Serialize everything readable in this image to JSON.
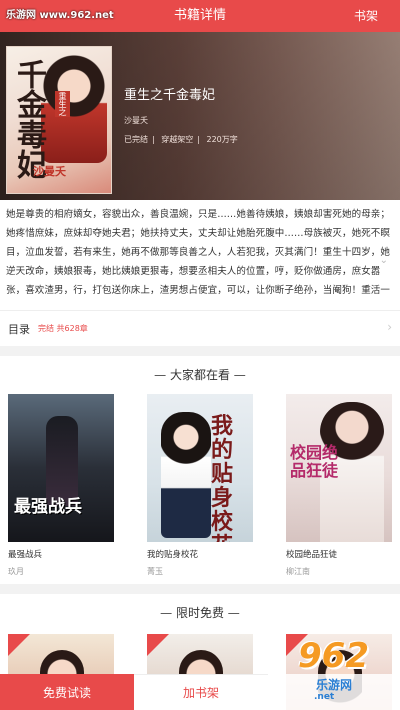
{
  "header": {
    "title": "书籍详情",
    "shelf_link": "书架",
    "watermark": "乐游网 www.962.net"
  },
  "book": {
    "title": "重生之千金毒妃",
    "author": "沙曼夭",
    "status": "已完结",
    "category": "穿越架空",
    "word_count": "220万字",
    "cover": {
      "title_text": "千金毒妃",
      "tag_text": "重生之",
      "author_text": "沙曼夭"
    },
    "description": "她是尊贵的相府嫡女，容貌出众，善良温婉，只是……她善待姨娘，姨娘却害死她的母亲；她疼惜庶妹，庶妹却夺她夫君；她扶持丈夫，丈夫却让她胎死腹中……母族被灭，她死不瞑目，泣血发誓，若有来生，她再不做那等良善之人，人若犯我，灭其满门！重生十四岁，她逆天改命，姨娘狠毒，她比姨娘更狠毒，想要丞相夫人的位置，哼，贬你做通房，庶女嚣张，喜欢渣男，行，打包送你床上，渣男想占便宜，可以，让你断子绝孙，当阉狗！重活一世，她言笑晏晏，伸手将迫害她的姨娘庶妹推进火坑，将渣男踩进泥土，将无情狠毒的父亲拉",
    "more_arrow": "⌄"
  },
  "toc": {
    "label": "目录",
    "info": "完结 共628章",
    "arrow": "›"
  },
  "popular": {
    "section_title": "— 大家都在看 —",
    "books": [
      {
        "title": "最强战兵",
        "author": "玖月",
        "cover_text": "最强战兵"
      },
      {
        "title": "我的贴身校花",
        "author": "菁玉",
        "cover_text": "我的贴身校花"
      },
      {
        "title": "校园绝品狂徒",
        "author": "柳江南",
        "cover_text": "校园绝品狂徒"
      }
    ]
  },
  "free": {
    "section_title": "— 限时免费 —"
  },
  "bottom": {
    "read_button": "免费试读",
    "shelf_button": "加书架"
  },
  "logo": {
    "number": "962",
    "name": "乐游网",
    "domain": ".net"
  },
  "colors": {
    "accent": "#e84a4a",
    "logo_orange": "#f59a23",
    "logo_blue": "#2a7fd4"
  }
}
